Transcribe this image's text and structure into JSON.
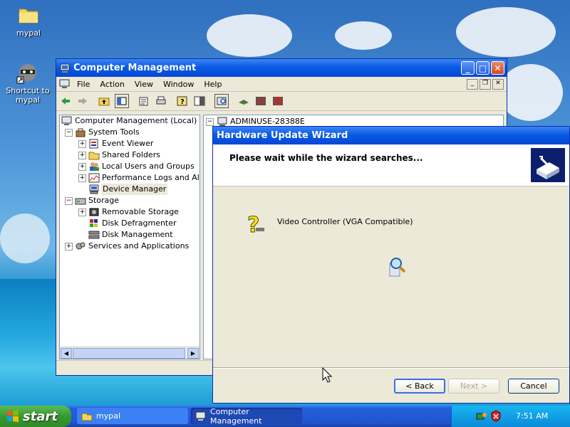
{
  "desktop": {
    "icons": [
      {
        "label": "mypal",
        "icon": "folder-icon"
      },
      {
        "label_line1": "Shortcut to",
        "label_line2": "mypal",
        "icon": "raccoon-shortcut-icon"
      }
    ]
  },
  "computer_management": {
    "title": "Computer Management",
    "menu": [
      "File",
      "Action",
      "View",
      "Window",
      "Help"
    ],
    "tree": {
      "root": "Computer Management (Local)",
      "system_tools": "System Tools",
      "event_viewer": "Event Viewer",
      "shared_folders": "Shared Folders",
      "local_users": "Local Users and Groups",
      "perf_logs": "Performance Logs and Alerts",
      "device_manager": "Device Manager",
      "storage": "Storage",
      "removable_storage": "Removable Storage",
      "disk_defrag": "Disk Defragmenter",
      "disk_mgmt": "Disk Management",
      "services_apps": "Services and Applications"
    },
    "right_pane": {
      "computer_node": "ADMINUSE-28388E"
    }
  },
  "wizard": {
    "title": "Hardware Update Wizard",
    "header_message": "Please wait while the wizard searches...",
    "device_name": "Video Controller (VGA Compatible)",
    "buttons": {
      "back": "< Back",
      "next": "Next >",
      "cancel": "Cancel"
    }
  },
  "taskbar": {
    "start_label": "start",
    "tasks": [
      {
        "label": "mypal",
        "state": "inactive"
      },
      {
        "label": "Computer Management",
        "state": "active"
      }
    ],
    "clock": "7:51 AM"
  },
  "colors": {
    "title_blue": "#0a5be4",
    "start_green": "#379a2f",
    "window_face": "#ece9d8",
    "tray_blue": "#0c8ad7"
  }
}
